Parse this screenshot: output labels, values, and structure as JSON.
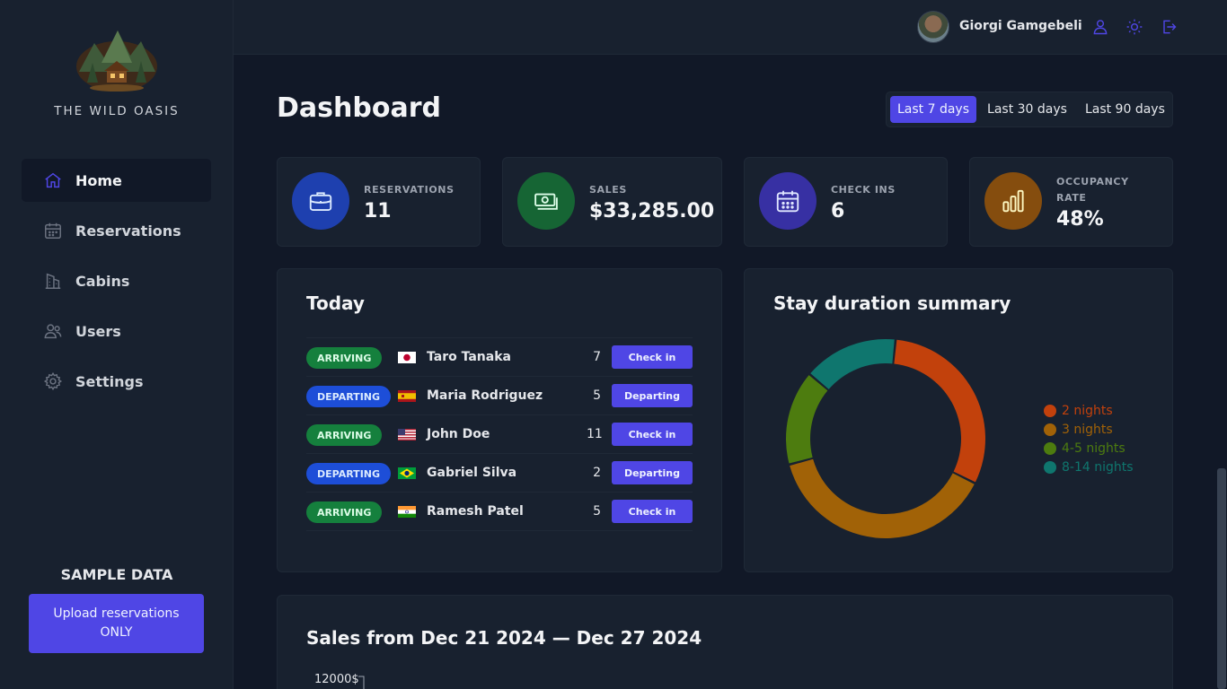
{
  "sidebar": {
    "brand": "THE WILD OASIS",
    "nav": [
      {
        "label": "Home",
        "icon": "home-icon",
        "active": true
      },
      {
        "label": "Reservations",
        "icon": "calendar-icon",
        "active": false
      },
      {
        "label": "Cabins",
        "icon": "building-icon",
        "active": false
      },
      {
        "label": "Users",
        "icon": "users-icon",
        "active": false
      },
      {
        "label": "Settings",
        "icon": "gear-icon",
        "active": false
      }
    ],
    "sample_title": "SAMPLE DATA",
    "upload_label": "Upload reservations ONLY"
  },
  "header": {
    "username": "Giorgi Gamgebeli",
    "icons": [
      "user-icon",
      "sun-icon",
      "logout-icon"
    ]
  },
  "main": {
    "title": "Dashboard",
    "filters": [
      {
        "label": "Last 7 days",
        "active": true
      },
      {
        "label": "Last 30 days",
        "active": false
      },
      {
        "label": "Last 90 days",
        "active": false
      }
    ],
    "stats": [
      {
        "label": "Reservations",
        "value": "11",
        "icon": "briefcase-icon",
        "color": "#1d4ed8"
      },
      {
        "label": "Sales",
        "value": "$33,285.00",
        "icon": "banknotes-icon",
        "color": "#15803d"
      },
      {
        "label": "Check ins",
        "value": "6",
        "icon": "calendar-days-icon",
        "color": "#3730a3"
      },
      {
        "label": "Occupancy rate",
        "value": "48%",
        "icon": "chart-bar-icon",
        "color": "#a16207"
      }
    ],
    "today": {
      "title": "Today",
      "rows": [
        {
          "status": "arriving",
          "status_label": "Arriving",
          "flag": "jp",
          "guest": "Taro Tanaka",
          "nights": "7",
          "action": "Check in"
        },
        {
          "status": "departing",
          "status_label": "Departing",
          "flag": "es",
          "guest": "Maria Rodriguez",
          "nights": "5",
          "action": "Departing"
        },
        {
          "status": "arriving",
          "status_label": "Arriving",
          "flag": "us",
          "guest": "John Doe",
          "nights": "11",
          "action": "Check in"
        },
        {
          "status": "departing",
          "status_label": "Departing",
          "flag": "br",
          "guest": "Gabriel Silva",
          "nights": "2",
          "action": "Departing"
        },
        {
          "status": "arriving",
          "status_label": "Arriving",
          "flag": "in",
          "guest": "Ramesh Patel",
          "nights": "5",
          "action": "Check in"
        }
      ]
    },
    "duration": {
      "title": "Stay duration summary"
    },
    "sales": {
      "title": "Sales from Dec 21 2024 — Dec 27 2024",
      "y_tick": "12000$"
    }
  },
  "chart_data": {
    "type": "pie",
    "title": "Stay duration summary",
    "categories": [
      "2 nights",
      "3 nights",
      "4-5 nights",
      "8-14 nights"
    ],
    "values": [
      4,
      5,
      2,
      2
    ],
    "colors": [
      "#c2410c",
      "#a16207",
      "#4d7c0f",
      "#0f766e"
    ],
    "legend": "right"
  }
}
